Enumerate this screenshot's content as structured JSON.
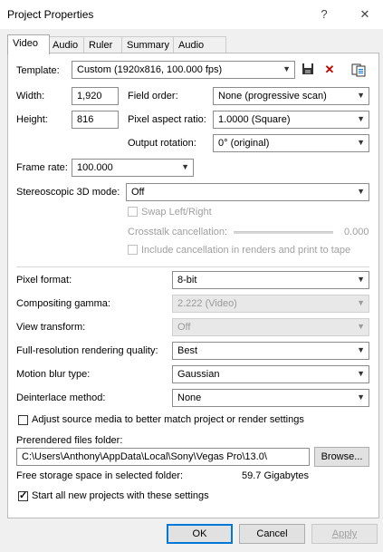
{
  "window": {
    "title": "Project Properties",
    "help_icon": "?",
    "close_icon": "✕"
  },
  "tabs": [
    {
      "label": "Video",
      "active": true
    },
    {
      "label": "Audio",
      "active": false
    },
    {
      "label": "Ruler",
      "active": false
    },
    {
      "label": "Summary",
      "active": false
    },
    {
      "label": "Audio CD",
      "active": false
    }
  ],
  "video": {
    "template_label": "Template:",
    "template_value": "Custom (1920x816, 100.000 fps)",
    "width_label": "Width:",
    "width_value": "1,920",
    "height_label": "Height:",
    "height_value": "816",
    "field_order_label": "Field order:",
    "field_order_value": "None (progressive scan)",
    "pixel_aspect_label": "Pixel aspect ratio:",
    "pixel_aspect_value": "1.0000 (Square)",
    "output_rotation_label": "Output rotation:",
    "output_rotation_value": "0° (original)",
    "frame_rate_label": "Frame rate:",
    "frame_rate_value": "100.000",
    "stereo_label": "Stereoscopic 3D mode:",
    "stereo_value": "Off",
    "swap_label": "Swap Left/Right",
    "crosstalk_label": "Crosstalk cancellation:",
    "crosstalk_value": "0.000",
    "include_cancel_label": "Include cancellation in renders and print to tape",
    "pixel_format_label": "Pixel format:",
    "pixel_format_value": "8-bit",
    "compositing_label": "Compositing gamma:",
    "compositing_value": "2.222 (Video)",
    "view_transform_label": "View transform:",
    "view_transform_value": "Off",
    "fullres_label": "Full-resolution rendering quality:",
    "fullres_value": "Best",
    "motion_blur_label": "Motion blur type:",
    "motion_blur_value": "Gaussian",
    "deinterlace_label": "Deinterlace method:",
    "deinterlace_value": "None",
    "adjust_source_label": "Adjust source media to better match project or render settings",
    "prerendered_label": "Prerendered files folder:",
    "prerendered_value": "C:\\Users\\Anthony\\AppData\\Local\\Sony\\Vegas Pro\\13.0\\",
    "browse_label": "Browse...",
    "free_storage_label": "Free storage space in selected folder:",
    "free_storage_value": "59.7 Gigabytes",
    "start_new_label": "Start all new projects with these settings"
  },
  "footer": {
    "ok": "OK",
    "cancel": "Cancel",
    "apply": "Apply"
  },
  "colors": {
    "accent": "#0078d7",
    "delete_icon": "#c00000"
  }
}
